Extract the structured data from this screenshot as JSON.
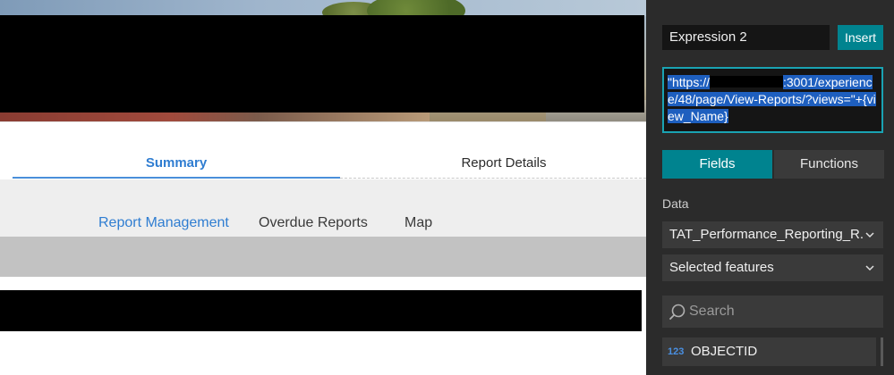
{
  "tabs_primary": [
    {
      "label": "Summary",
      "active": true
    },
    {
      "label": "Report Details",
      "active": false
    }
  ],
  "tabs_secondary": [
    {
      "label": "Report Management",
      "active": true
    },
    {
      "label": "Overdue Reports",
      "active": false
    },
    {
      "label": "Map",
      "active": false
    }
  ],
  "expression_panel": {
    "name_value": "Expression 2",
    "insert_label": "Insert",
    "expression_prefix": "\"https://",
    "expression_suffix": ":3001/experience/48/page/View-Reports/?views=\"+{view_Name}",
    "segments": {
      "fields": "Fields",
      "functions": "Functions",
      "active": "fields"
    },
    "data_label": "Data",
    "data_source": "TAT_Performance_Reporting_R...",
    "selection_mode": "Selected features",
    "search_placeholder": "Search",
    "fields": [
      {
        "type": "123",
        "name": "OBJECTID"
      }
    ]
  },
  "colors": {
    "accent_teal": "#00838f",
    "tab_blue": "#2f7dd1",
    "panel_bg": "#2b2b2b"
  },
  "icons": [
    "chevron-down-icon",
    "search-icon",
    "number-type-icon"
  ]
}
